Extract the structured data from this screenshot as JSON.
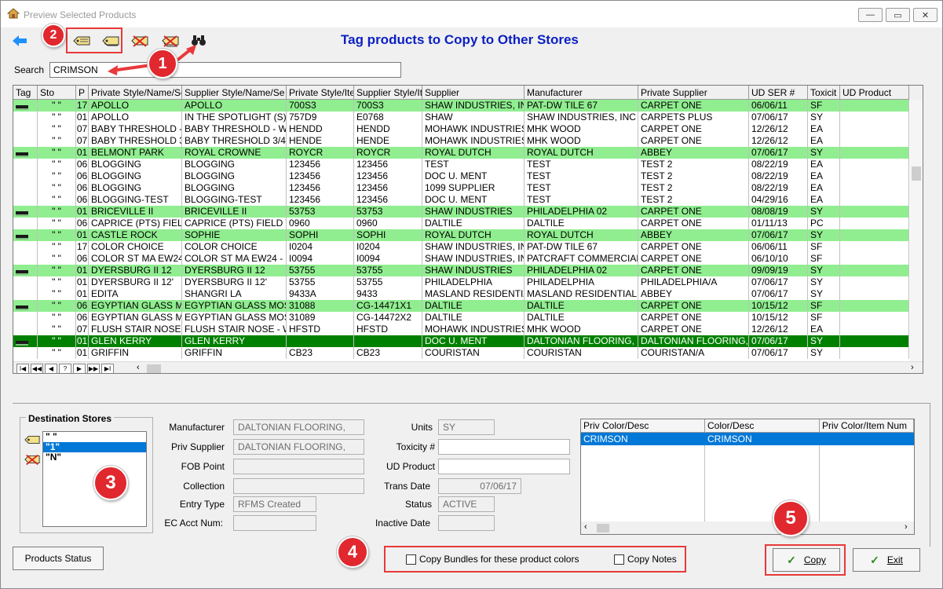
{
  "window": {
    "title": "Preview Selected Products",
    "min": "—",
    "max": "▭",
    "close": "✕"
  },
  "heading": "Tag products to Copy to Other Stores",
  "search": {
    "label": "Search",
    "value": "CRIMSON"
  },
  "columns": [
    "Tag",
    "Sto",
    "P",
    "Private Style/Name/Serv",
    "Supplier Style/Name/Se",
    "Private Style/Ite",
    "Supplier Style/It",
    "Supplier",
    "Manufacturer",
    "Private Supplier",
    "UD SER #",
    "Toxicit",
    "UD Product"
  ],
  "rows": [
    {
      "tagged": true,
      "sto": "\" \"",
      "p": "17",
      "pstyle": "APOLLO",
      "sstyle": "APOLLO",
      "pitem": "700S3",
      "sitem": "700S3",
      "supplier": "SHAW INDUSTRIES, INC",
      "mfr": "PAT-DW TILE 67",
      "psupp": "CARPET ONE",
      "udser": "06/06/11",
      "tox": "SF",
      "udprod": ""
    },
    {
      "tagged": false,
      "sto": "\" \"",
      "p": "01",
      "pstyle": "APOLLO",
      "sstyle": "IN THE SPOTLIGHT (S)",
      "pitem": "757D9",
      "sitem": "E0768",
      "supplier": "SHAW",
      "mfr": "SHAW INDUSTRIES, INC",
      "psupp": "CARPETS PLUS",
      "udser": "07/06/17",
      "tox": "SY",
      "udprod": ""
    },
    {
      "tagged": false,
      "sto": "\" \"",
      "p": "07",
      "pstyle": "BABY THRESHOLD - WO",
      "sstyle": "BABY THRESHOLD - WO",
      "pitem": "HENDD",
      "sitem": "HENDD",
      "supplier": "MOHAWK INDUSTRIES",
      "mfr": "MHK WOOD",
      "psupp": "CARPET ONE",
      "udser": "12/26/12",
      "tox": "EA",
      "udprod": ""
    },
    {
      "tagged": false,
      "sto": "\" \"",
      "p": "07",
      "pstyle": "BABY THRESHOLD 3/4\" -",
      "sstyle": "BABY THRESHOLD 3/4\" -",
      "pitem": "HENDE",
      "sitem": "HENDE",
      "supplier": "MOHAWK INDUSTRIES",
      "mfr": "MHK WOOD",
      "psupp": "CARPET ONE",
      "udser": "12/26/12",
      "tox": "EA",
      "udprod": ""
    },
    {
      "tagged": true,
      "sto": "\" \"",
      "p": "01",
      "pstyle": "BELMONT PARK",
      "sstyle": "ROYAL CROWNE",
      "pitem": "ROYCR",
      "sitem": "ROYCR",
      "supplier": "ROYAL DUTCH",
      "mfr": "ROYAL DUTCH",
      "psupp": "ABBEY",
      "udser": "07/06/17",
      "tox": "SY",
      "udprod": ""
    },
    {
      "tagged": false,
      "sto": "\" \"",
      "p": "06",
      "pstyle": "BLOGGING",
      "sstyle": "BLOGGING",
      "pitem": "123456",
      "sitem": "123456",
      "supplier": "TEST",
      "mfr": "TEST",
      "psupp": "TEST 2",
      "udser": "08/22/19",
      "tox": "EA",
      "udprod": ""
    },
    {
      "tagged": false,
      "sto": "\" \"",
      "p": "06",
      "pstyle": "BLOGGING",
      "sstyle": "BLOGGING",
      "pitem": "123456",
      "sitem": "123456",
      "supplier": "DOC U. MENT",
      "mfr": "TEST",
      "psupp": "TEST 2",
      "udser": "08/22/19",
      "tox": "EA",
      "udprod": ""
    },
    {
      "tagged": false,
      "sto": "\" \"",
      "p": "06",
      "pstyle": "BLOGGING",
      "sstyle": "BLOGGING",
      "pitem": "123456",
      "sitem": "123456",
      "supplier": "1099 SUPPLIER",
      "mfr": "TEST",
      "psupp": "TEST 2",
      "udser": "08/22/19",
      "tox": "EA",
      "udprod": ""
    },
    {
      "tagged": false,
      "sto": "\" \"",
      "p": "06",
      "pstyle": "BLOGGING-TEST",
      "sstyle": "BLOGGING-TEST",
      "pitem": "123456",
      "sitem": "123456",
      "supplier": "DOC U. MENT",
      "mfr": "TEST",
      "psupp": "TEST 2",
      "udser": "04/29/16",
      "tox": "EA",
      "udprod": ""
    },
    {
      "tagged": true,
      "sto": "\" \"",
      "p": "01",
      "pstyle": "BRICEVILLE  II",
      "sstyle": "BRICEVILLE  II",
      "pitem": "53753",
      "sitem": "53753",
      "supplier": "SHAW INDUSTRIES",
      "mfr": "PHILADELPHIA 02",
      "psupp": "CARPET ONE",
      "udser": "08/08/19",
      "tox": "SY",
      "udprod": ""
    },
    {
      "tagged": false,
      "sto": "\" \"",
      "p": "06",
      "pstyle": "CAPRICE (PTS) FIELD TILE",
      "sstyle": "CAPRICE (PTS) FIELD TILE",
      "pitem": "0960",
      "sitem": "0960",
      "supplier": "DALTILE",
      "mfr": "DALTILE",
      "psupp": "CARPET ONE",
      "udser": "01/11/13",
      "tox": "PC",
      "udprod": ""
    },
    {
      "tagged": true,
      "sto": "\" \"",
      "p": "01",
      "pstyle": "CASTLE ROCK",
      "sstyle": "SOPHIE",
      "pitem": "SOPHI",
      "sitem": "SOPHI",
      "supplier": "ROYAL DUTCH",
      "mfr": "ROYAL DUTCH",
      "psupp": "ABBEY",
      "udser": "07/06/17",
      "tox": "SY",
      "udprod": ""
    },
    {
      "tagged": false,
      "sto": "\" \"",
      "p": "17",
      "pstyle": "COLOR CHOICE",
      "sstyle": "COLOR CHOICE",
      "pitem": "I0204",
      "sitem": "I0204",
      "supplier": "SHAW INDUSTRIES, INC",
      "mfr": "PAT-DW TILE 67",
      "psupp": "CARPET ONE",
      "udser": "06/06/11",
      "tox": "SF",
      "udprod": ""
    },
    {
      "tagged": false,
      "sto": "\" \"",
      "p": "06",
      "pstyle": "COLOR ST MA EW24 - 24",
      "sstyle": "COLOR ST MA EW24 - 24",
      "pitem": "I0094",
      "sitem": "I0094",
      "supplier": "SHAW INDUSTRIES, INC",
      "mfr": "PATCRAFT COMMERCIAL",
      "psupp": "CARPET ONE",
      "udser": "06/10/10",
      "tox": "SF",
      "udprod": ""
    },
    {
      "tagged": true,
      "sto": "\" \"",
      "p": "01",
      "pstyle": "DYERSBURG II 12",
      "sstyle": "DYERSBURG II 12",
      "pitem": "53755",
      "sitem": "53755",
      "supplier": "SHAW INDUSTRIES",
      "mfr": "PHILADELPHIA 02",
      "psupp": "CARPET ONE",
      "udser": "09/09/19",
      "tox": "SY",
      "udprod": ""
    },
    {
      "tagged": false,
      "sto": "\" \"",
      "p": "01",
      "pstyle": "DYERSBURG II 12'",
      "sstyle": "DYERSBURG II 12'",
      "pitem": "53755",
      "sitem": "53755",
      "supplier": "PHILADELPHIA",
      "mfr": "PHILADELPHIA",
      "psupp": "PHILADELPHIA/A",
      "udser": "07/06/17",
      "tox": "SY",
      "udprod": ""
    },
    {
      "tagged": false,
      "sto": "\" \"",
      "p": "01",
      "pstyle": "EDITA",
      "sstyle": "SHANGRI LA",
      "pitem": "9433A",
      "sitem": "9433",
      "supplier": "MASLAND RESIDENTIAL",
      "mfr": "MASLAND RESIDENTIAL",
      "psupp": "ABBEY",
      "udser": "07/06/17",
      "tox": "SY",
      "udprod": ""
    },
    {
      "tagged": true,
      "sto": "\" \"",
      "p": "06",
      "pstyle": "EGYPTIAN GLASS MOSAI",
      "sstyle": "EGYPTIAN GLASS MOSA",
      "pitem": "31088",
      "sitem": "CG-14471X1",
      "supplier": "DALTILE",
      "mfr": "DALTILE",
      "psupp": "CARPET ONE",
      "udser": "10/15/12",
      "tox": "SF",
      "udprod": ""
    },
    {
      "tagged": false,
      "sto": "\" \"",
      "p": "06",
      "pstyle": "EGYPTIAN GLASS MOSAI",
      "sstyle": "EGYPTIAN GLASS MOSA",
      "pitem": "31089",
      "sitem": "CG-14472X2",
      "supplier": "DALTILE",
      "mfr": "DALTILE",
      "psupp": "CARPET ONE",
      "udser": "10/15/12",
      "tox": "SF",
      "udprod": ""
    },
    {
      "tagged": false,
      "sto": "\" \"",
      "p": "07",
      "pstyle": "FLUSH STAIR NOSE - WO",
      "sstyle": "FLUSH STAIR NOSE - WO",
      "pitem": "HFSTD",
      "sitem": "HFSTD",
      "supplier": "MOHAWK INDUSTRIES",
      "mfr": "MHK WOOD",
      "psupp": "CARPET ONE",
      "udser": "12/26/12",
      "tox": "EA",
      "udprod": ""
    },
    {
      "tagged": true,
      "selected": true,
      "sto": "\" \"",
      "p": "01",
      "pstyle": "GLEN KERRY",
      "sstyle": "GLEN KERRY",
      "pitem": "",
      "sitem": "",
      "supplier": "DOC U. MENT",
      "mfr": "DALTONIAN FLOORING,",
      "psupp": "DALTONIAN FLOORING,",
      "udser": "07/06/17",
      "tox": "SY",
      "udprod": ""
    },
    {
      "tagged": false,
      "sto": "\" \"",
      "p": "01",
      "pstyle": "GRIFFIN",
      "sstyle": "GRIFFIN",
      "pitem": "CB23",
      "sitem": "CB23",
      "supplier": "COURISTAN",
      "mfr": "COURISTAN",
      "psupp": "COURISTAN/A",
      "udser": "07/06/17",
      "tox": "SY",
      "udprod": ""
    }
  ],
  "grid_nav": [
    "I◀",
    "◀◀",
    "◀",
    "?",
    "▶",
    "▶▶",
    "▶I"
  ],
  "destination": {
    "title": "Destination Stores",
    "items": [
      "\" \"",
      "\"1\"",
      "\"N\""
    ],
    "selected_index": 1
  },
  "fields": {
    "manufacturer": {
      "label": "Manufacturer",
      "value": "DALTONIAN FLOORING,"
    },
    "priv_supplier": {
      "label": "Priv Supplier",
      "value": "DALTONIAN FLOORING,"
    },
    "fob_point": {
      "label": "FOB Point",
      "value": ""
    },
    "collection": {
      "label": "Collection",
      "value": ""
    },
    "entry_type": {
      "label": "Entry Type",
      "value": "RFMS Created"
    },
    "ec_acct": {
      "label": "EC Acct Num:",
      "value": ""
    },
    "units": {
      "label": "Units",
      "value": "SY"
    },
    "toxicity": {
      "label": "Toxicity #",
      "value": ""
    },
    "ud_product": {
      "label": "UD Product",
      "value": ""
    },
    "trans_date": {
      "label": "Trans Date",
      "value": "07/06/17"
    },
    "status": {
      "label": "Status",
      "value": "ACTIVE"
    },
    "inactive_date": {
      "label": "Inactive Date",
      "value": ""
    }
  },
  "colors": {
    "headers": [
      "Priv Color/Desc",
      "Color/Desc",
      "Priv Color/Item Num"
    ],
    "rows": [
      [
        "CRIMSON",
        "CRIMSON",
        ""
      ]
    ]
  },
  "buttons": {
    "products_status": "Products Status",
    "copy": "Copy",
    "exit": "Exit"
  },
  "options": {
    "copy_bundles": "Copy Bundles for these product colors",
    "copy_notes": "Copy Notes"
  },
  "badges": [
    "1",
    "2",
    "3",
    "4",
    "5"
  ],
  "colors_theme": {
    "tag_green": "#90ee90",
    "selected_green": "#008000",
    "heading_blue": "#0b1fc2",
    "selection_blue": "#0078d7",
    "badge_red": "#e0282e"
  }
}
